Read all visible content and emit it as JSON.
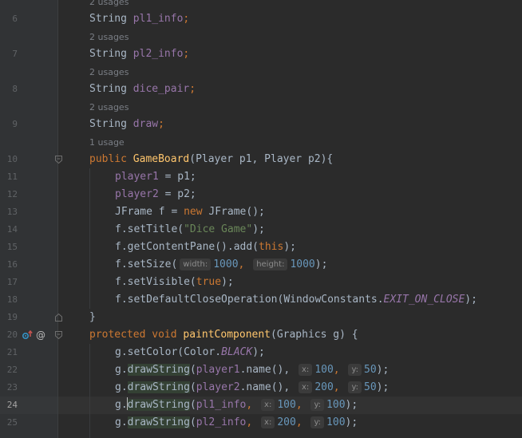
{
  "usages": {
    "u_top": "2 usages",
    "u6": "2 usages",
    "u7": "2 usages",
    "u8": "2 usages",
    "u9": "1 usage"
  },
  "line_numbers": {
    "l6": "6",
    "l7": "7",
    "l8": "8",
    "l9": "9",
    "l10": "10",
    "l11": "11",
    "l12": "12",
    "l13": "13",
    "l14": "14",
    "l15": "15",
    "l16": "16",
    "l17": "17",
    "l18": "18",
    "l19": "19",
    "l20": "20",
    "l21": "21",
    "l22": "22",
    "l23": "23",
    "l24": "24",
    "l25": "25"
  },
  "code": {
    "t_String": "String",
    "f_pl1_info": "pl1_info",
    "f_pl2_info": "pl2_info",
    "f_dice_pair": "dice_pair",
    "f_draw": "draw",
    "semi": ";",
    "kw_public": "public",
    "fn_GameBoard": "GameBoard",
    "ctor_params": "(Player p1, Player p2){",
    "f_player1": "player1",
    "f_player2": "player2",
    "eq_p1": " = p1;",
    "eq_p2": " = p2;",
    "l13_a": "JFrame f = ",
    "kw_new": "new",
    "l13_b": " JFrame();",
    "l14_a": "f.setTitle(",
    "str_title": "\"Dice Game\"",
    "l14_b": ");",
    "l15_a": "f.getContentPane().add(",
    "kw_this": "this",
    "l15_b": ");",
    "l16_a": "f.setSize(",
    "hint_width": "width:",
    "num_1000a": "1000",
    "comma": ",",
    "hint_height": "height:",
    "num_1000b": "1000",
    "l16_b": ");",
    "l17_a": "f.setVisible(",
    "kw_true": "true",
    "l17_b": ");",
    "l18_a": "f.setDefaultCloseOperation(WindowConstants.",
    "sf_exit": "EXIT_ON_CLOSE",
    "l18_b": ");",
    "brace_close": "}",
    "kw_protected": "protected",
    "kw_void": "void",
    "fn_paint": "paintComponent",
    "paint_params": "(Graphics g) {",
    "l21_a": "g.setColor(Color.",
    "sf_black": "BLACK",
    "l21_b": ");",
    "g_dot": "g.",
    "drawString": "drawString",
    "paren_open": "(",
    "name_call": ".name(),",
    "hint_x": "x:",
    "hint_y": "y:",
    "num_100": "100",
    "num_200": "200",
    "num_50": "50",
    "close_semi": ");"
  },
  "gutter_icons": {
    "override": "up-arrow-override-icon",
    "annotation": "@"
  }
}
